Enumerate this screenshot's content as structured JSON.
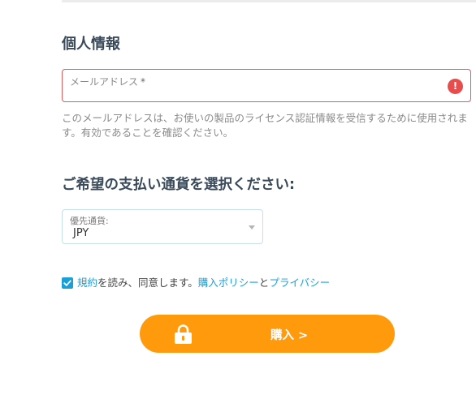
{
  "personal_info": {
    "title": "個人情報",
    "email": {
      "label": "メールアドレス",
      "required_mark": "*",
      "value": "",
      "error_icon": "!"
    },
    "help_text": "このメールアドレスは、お使いの製品のライセンス認証情報を受信するために使用されます。有効であることを確認ください。"
  },
  "currency": {
    "title": "ご希望の支払い通貨を選択ください:",
    "select_label": "優先通貨:",
    "selected_value": "JPY"
  },
  "agreement": {
    "checked": true,
    "terms_link": "規約",
    "text_middle": "を読み、同意します。",
    "purchase_policy_link": "購入ポリシー",
    "conjunction": "と",
    "privacy_link": "プライバシー"
  },
  "purchase_button": {
    "label": "購入 >",
    "icon": "lock-icon"
  },
  "colors": {
    "accent": "#ff9a0d",
    "link": "#1a9fd6",
    "error": "#e84d4d",
    "heading": "#3a4a5a"
  }
}
